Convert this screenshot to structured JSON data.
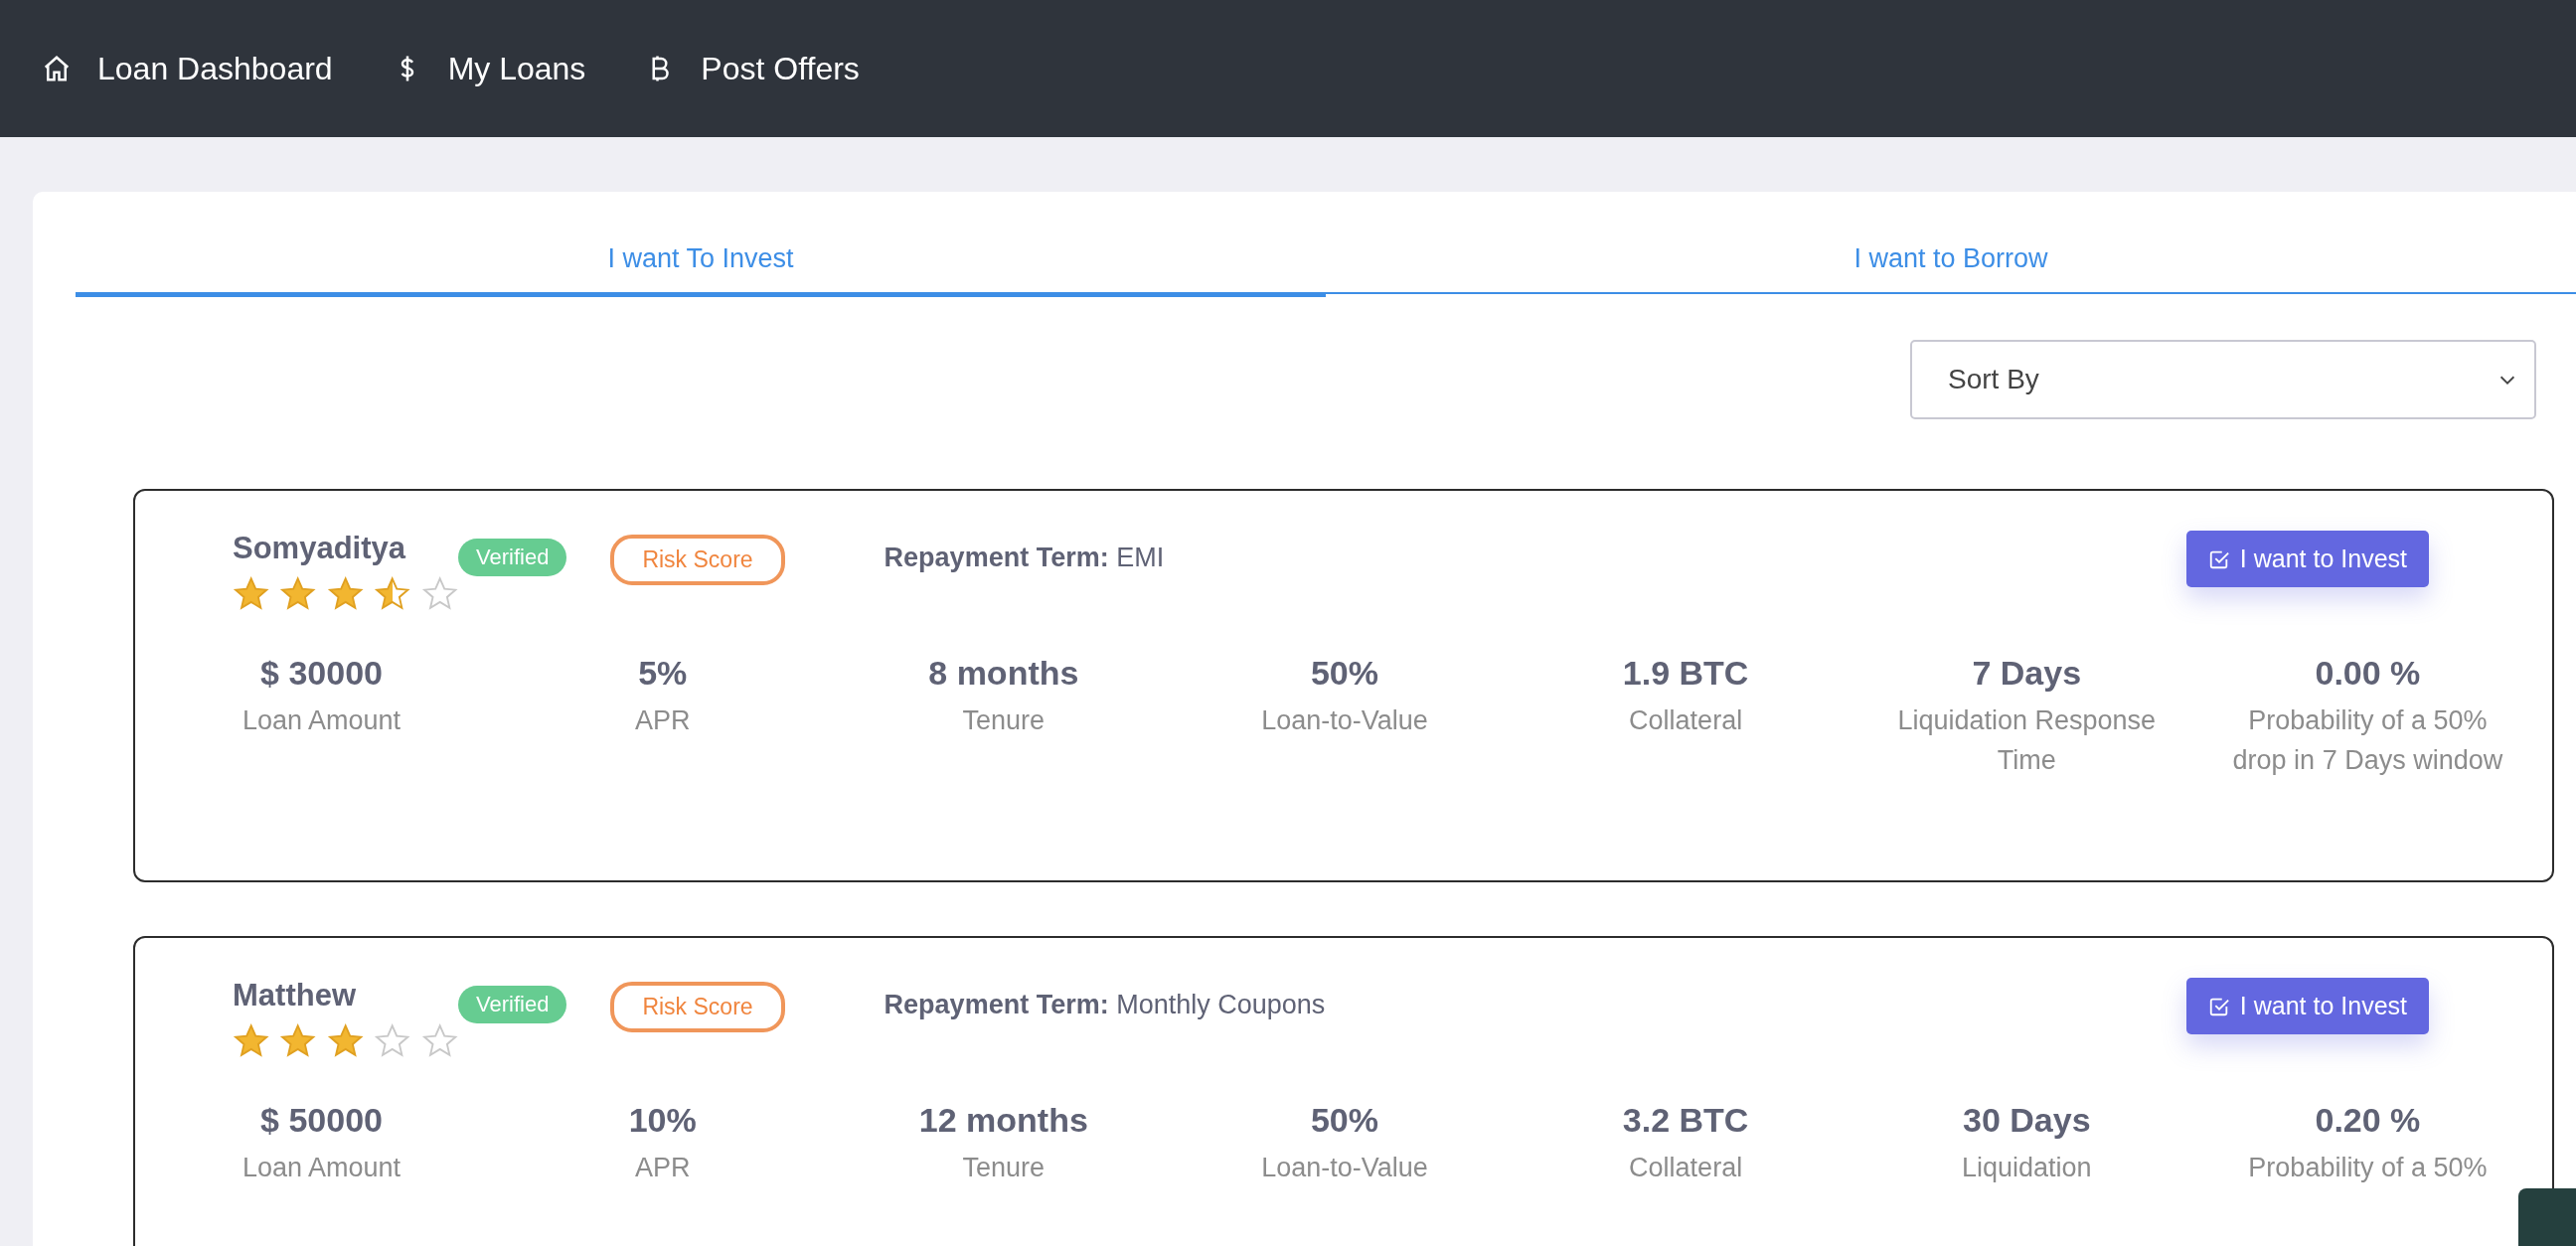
{
  "nav": [
    {
      "kind": "home",
      "label": "Loan Dashboard"
    },
    {
      "kind": "dollar",
      "label": "My Loans"
    },
    {
      "kind": "bitcoin",
      "label": "Post Offers"
    }
  ],
  "tabs": [
    {
      "label": "I want To Invest",
      "selected": true
    },
    {
      "label": "I want to Borrow",
      "selected": false
    }
  ],
  "sort": {
    "placeholder": "Sort By"
  },
  "offers": [
    {
      "name": "Somyaditya",
      "stars": 3.5,
      "badge": "Verified",
      "risk": "Risk Score",
      "term_label": "Repayment Term:",
      "term": "EMI",
      "button": "I want to Invest",
      "stats": [
        {
          "value": "$ 30000",
          "label": "Loan Amount"
        },
        {
          "value": "5%",
          "label": "APR"
        },
        {
          "value": "8 months",
          "label": "Tenure"
        },
        {
          "value": "50%",
          "label": "Loan-to-Value"
        },
        {
          "value": "1.9 BTC",
          "label": "Collateral"
        },
        {
          "value": "7 Days",
          "label": "Liquidation Response Time"
        },
        {
          "value": "0.00 %",
          "label": "Probability of a 50% drop in 7 Days window"
        }
      ]
    },
    {
      "name": "Matthew",
      "stars": 3,
      "badge": "Verified",
      "risk": "Risk Score",
      "term_label": "Repayment Term:",
      "term": "Monthly Coupons",
      "button": "I want to Invest",
      "stats": [
        {
          "value": "$ 50000",
          "label": "Loan Amount"
        },
        {
          "value": "10%",
          "label": "APR"
        },
        {
          "value": "12 months",
          "label": "Tenure"
        },
        {
          "value": "50%",
          "label": "Loan-to-Value"
        },
        {
          "value": "3.2 BTC",
          "label": "Collateral"
        },
        {
          "value": "30 Days",
          "label": "Liquidation"
        },
        {
          "value": "0.20 %",
          "label": "Probability of a 50%"
        }
      ]
    }
  ]
}
